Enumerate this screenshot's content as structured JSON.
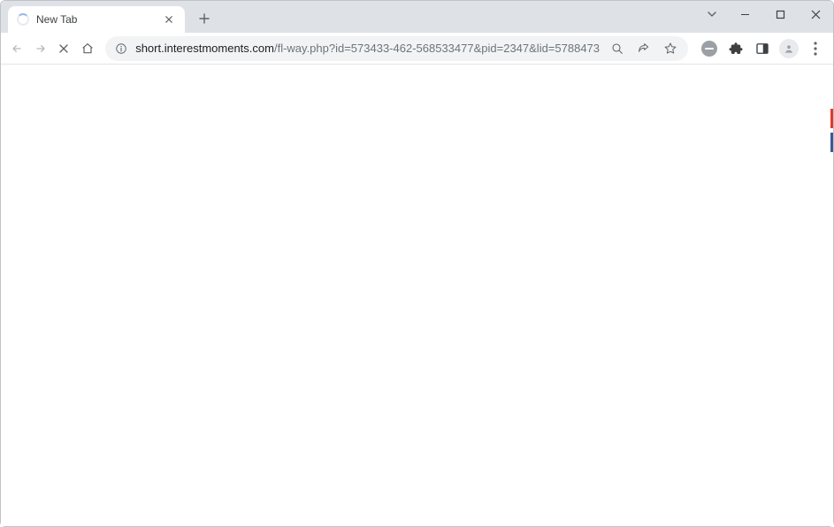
{
  "tab": {
    "title": "New Tab"
  },
  "address": {
    "host": "short.interestmoments.com",
    "path": "/fl-way.php?id=573433-462-568533477&pid=2347&lid=5788473"
  }
}
